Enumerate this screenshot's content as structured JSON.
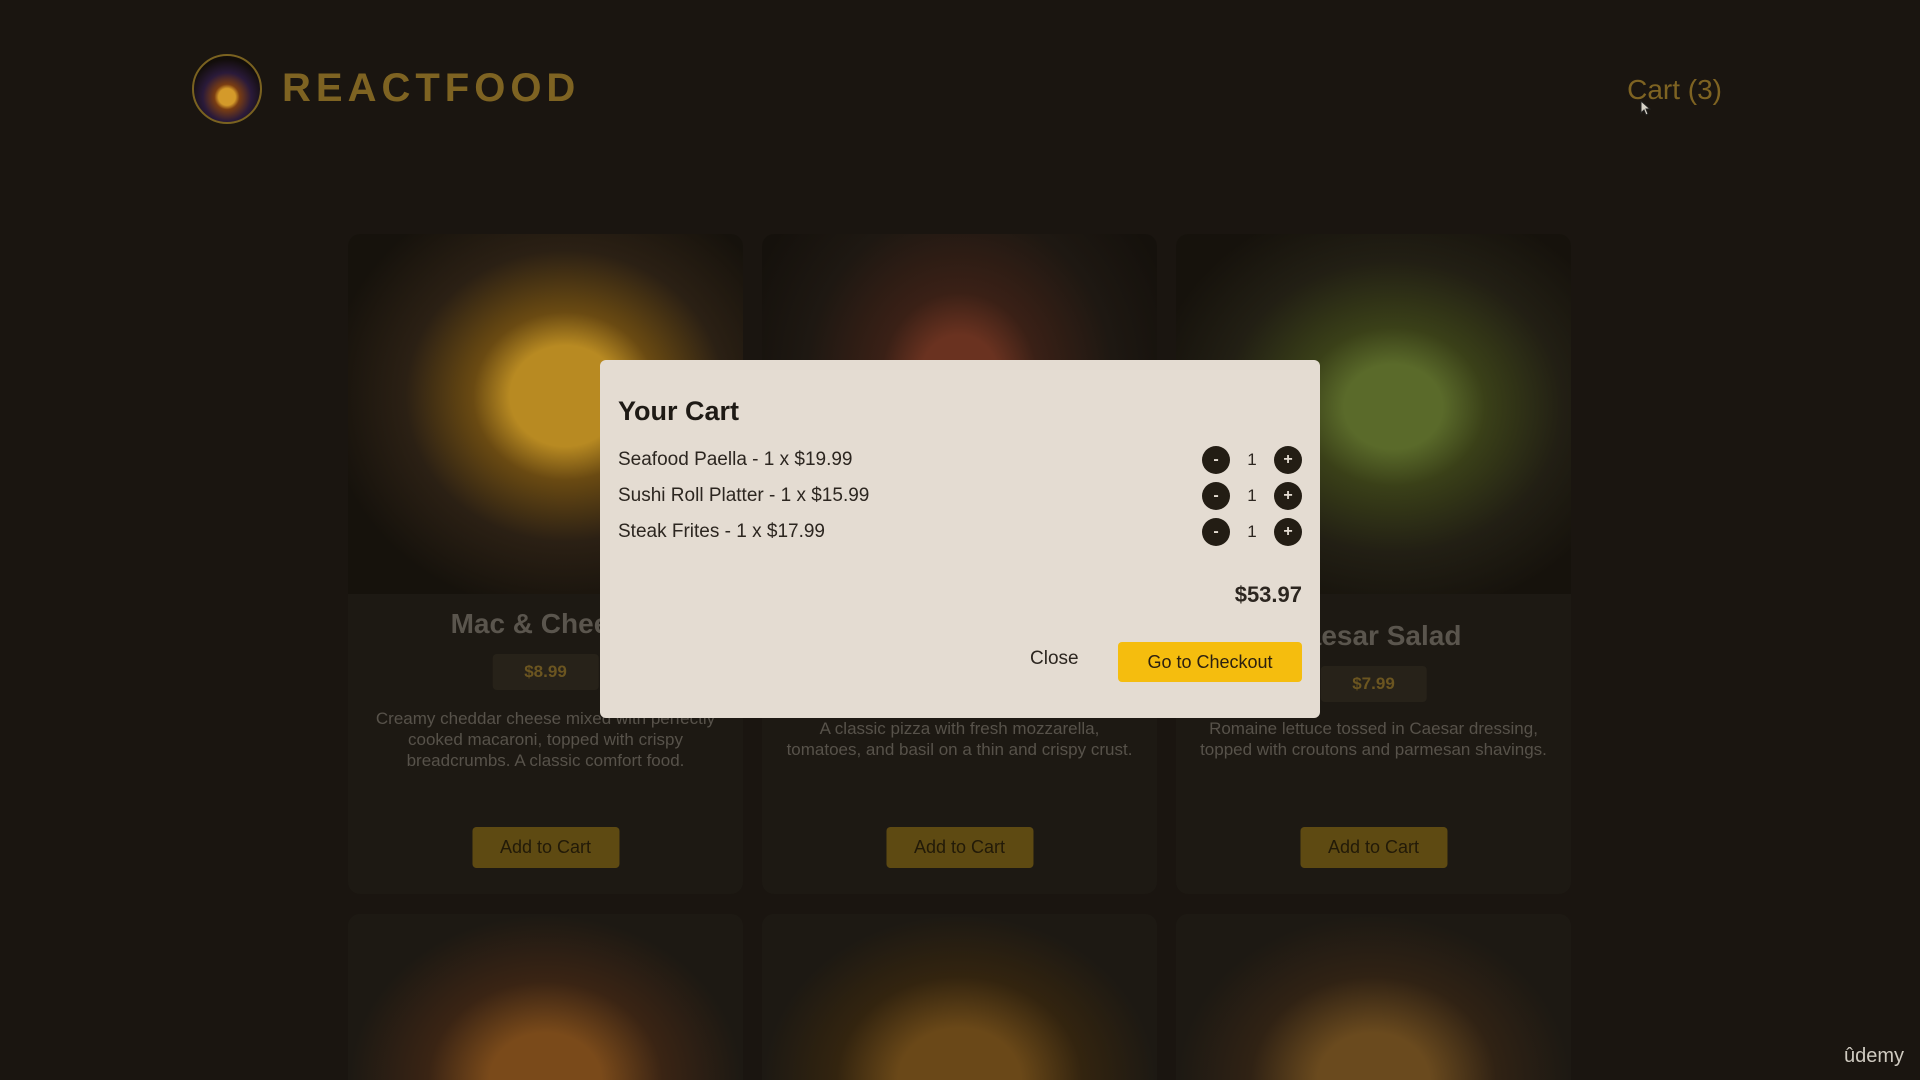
{
  "header": {
    "title": "REACTFOOD",
    "cart_label": "Cart (3)"
  },
  "meals": [
    {
      "name": "Mac & Cheese",
      "price": "$8.99",
      "description": "Creamy cheddar cheese mixed with perfectly cooked macaroni, topped with crispy breadcrumbs. A classic comfort food.",
      "add_label": "Add to Cart"
    },
    {
      "name": "",
      "price": "",
      "description": "A classic pizza with fresh mozzarella, tomatoes, and basil on a thin and crispy crust.",
      "add_label": "Add to Cart"
    },
    {
      "name": "Caesar Salad",
      "price": "$7.99",
      "description": "Romaine lettuce tossed in Caesar dressing, topped with croutons and parmesan shavings.",
      "add_label": "Add to Cart"
    }
  ],
  "cart_modal": {
    "title": "Your Cart",
    "items": [
      {
        "label": "Seafood Paella - 1 x $19.99",
        "quantity": "1",
        "minus": "-",
        "plus": "+"
      },
      {
        "label": "Sushi Roll Platter - 1 x $15.99",
        "quantity": "1",
        "minus": "-",
        "plus": "+"
      },
      {
        "label": "Steak Frites - 1 x $17.99",
        "quantity": "1",
        "minus": "-",
        "plus": "+"
      }
    ],
    "total": "$53.97",
    "close_label": "Close",
    "checkout_label": "Go to Checkout"
  },
  "watermark": "ûdemy",
  "colors": {
    "accent": "#f5bd0e",
    "modal_bg": "#e4dcd2",
    "page_bg": "#1a1510"
  }
}
